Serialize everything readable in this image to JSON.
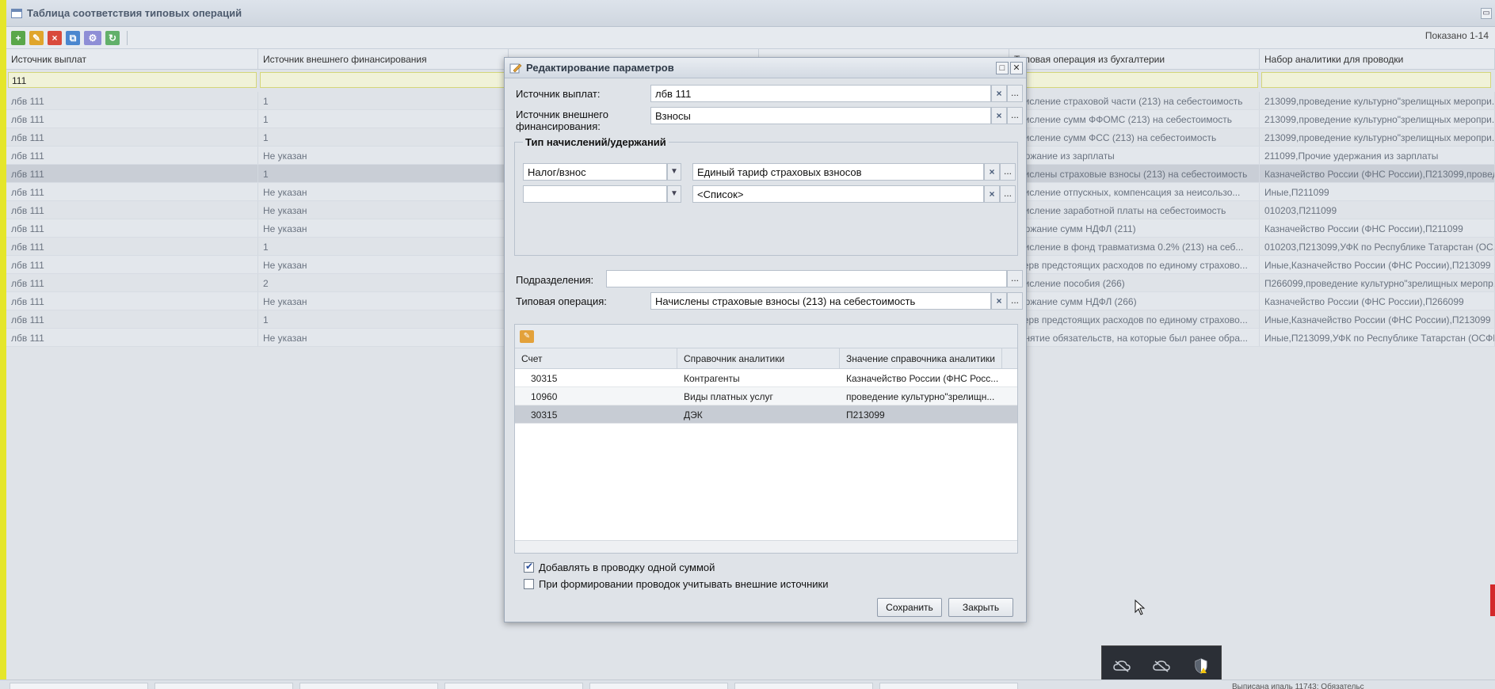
{
  "window": {
    "title": "Таблица соответствия типовых операций",
    "minimize_glyph": "▭",
    "shown_label": "Показано 1-14"
  },
  "grid": {
    "columns": [
      "Источник выплат",
      "Источник внешнего финансирования",
      "",
      "",
      "Типовая операция из бухгалтерии",
      "Набор аналитики для проводки"
    ],
    "filter_value": "111",
    "rows": [
      {
        "src": "лбв 111",
        "ext": "1",
        "op": "ачисление страховой части (213) на себестоимость",
        "set": "213099,проведение культурно\"зрелищных меропри..."
      },
      {
        "src": "лбв 111",
        "ext": "1",
        "op": "ачисление сумм ФФОМС (213) на себестоимость",
        "set": "213099,проведение культурно\"зрелищных меропри..."
      },
      {
        "src": "лбв 111",
        "ext": "1",
        "op": "ачисление сумм ФСС (213) на себестоимость",
        "set": "213099,проведение культурно\"зрелищных меропри..."
      },
      {
        "src": "лбв 111",
        "ext": "Не указан",
        "op": "держание из зарплаты",
        "set": "211099,Прочие удержания из зарплаты"
      },
      {
        "src": "лбв 111",
        "ext": "1",
        "op": "ачислены страховые взносы (213) на себестоимость",
        "set": "Казначейство России (ФНС России),П213099,провед"
      },
      {
        "src": "лбв 111",
        "ext": "Не указан",
        "op": "ачисление отпускных, компенсация за неисользо...",
        "set": "Иные,П211099"
      },
      {
        "src": "лбв 111",
        "ext": "Не указан",
        "op": "ачисление заработной платы на себестоимость",
        "set": "010203,П211099"
      },
      {
        "src": "лбв 111",
        "ext": "Не указан",
        "op": "держание сумм НДФЛ (211)",
        "set": "Казначейство России (ФНС России),П211099"
      },
      {
        "src": "лбв 111",
        "ext": "1",
        "op": "ачисление в фонд травматизма 0.2% (213) на себ...",
        "set": "010203,П213099,УФК по Республике Татарстан (ОС..."
      },
      {
        "src": "лбв 111",
        "ext": "Не указан",
        "op": "езерв предстоящих расходов по единому страхово...",
        "set": "Иные,Казначейство России (ФНС России),П213099"
      },
      {
        "src": "лбв 111",
        "ext": "2",
        "op": "ачисление пособия (266)",
        "set": "П266099,проведение культурно\"зрелищных меропр..."
      },
      {
        "src": "лбв 111",
        "ext": "Не указан",
        "op": "держание сумм НДФЛ (266)",
        "set": "Казначейство России (ФНС России),П266099"
      },
      {
        "src": "лбв 111",
        "ext": "1",
        "op": "езерв предстоящих расходов по единому страхово...",
        "set": "Иные,Казначейство России (ФНС России),П213099"
      },
      {
        "src": "лбв 111",
        "ext": "Не указан",
        "op": "ринятие обязательств, на которые был ранее обра...",
        "set": "Иные,П213099,УФК по Республике Татарстан (ОСФР"
      }
    ]
  },
  "dialog": {
    "title": "Редактирование параметров",
    "payment_source_label": "Источник выплат:",
    "payment_source_value": "лбв 111",
    "ext_source_label": "Источник внешнего финансирования:",
    "ext_source_value": "Взносы",
    "accruals_legend": "Тип начислений/удержаний",
    "accrual1_type": "Налог/взнос",
    "accrual1_value": "Единый тариф страховых взносов",
    "accrual2_type": "",
    "accrual2_value": "<Список>",
    "subdivisions_label": "Подразделения:",
    "subdivisions_value": "",
    "typical_op_label": "Типовая операция:",
    "typical_op_value": "Начислены страховые взносы (213) на себестоимость",
    "analytics": {
      "headers": [
        "Счет",
        "Справочник аналитики",
        "Значение справочника аналитики"
      ],
      "rows": [
        {
          "account": "30315",
          "ref": "Контрагенты",
          "value": "Казначейство России (ФНС Росс..."
        },
        {
          "account": "10960",
          "ref": "Виды платных услуг",
          "value": "проведение культурно\"зрелищн..."
        },
        {
          "account": "30315",
          "ref": "ДЭК",
          "value": "П213099"
        }
      ]
    },
    "check_one_sum": "Добавлять в проводку одной суммой",
    "check_one_sum_checked": true,
    "check_ext_sources": "При формировании проводок учитывать внешние источники",
    "check_ext_sources_checked": false,
    "save_label": "Сохранить",
    "close_label": "Закрыть",
    "clear_glyph": "×",
    "dots_glyph": "...",
    "arrow_glyph": "▼",
    "maximize_glyph": "□",
    "close_glyph": "✕"
  },
  "status_bar": {
    "text": "Выписана ипаль 11743; Обязательс"
  }
}
